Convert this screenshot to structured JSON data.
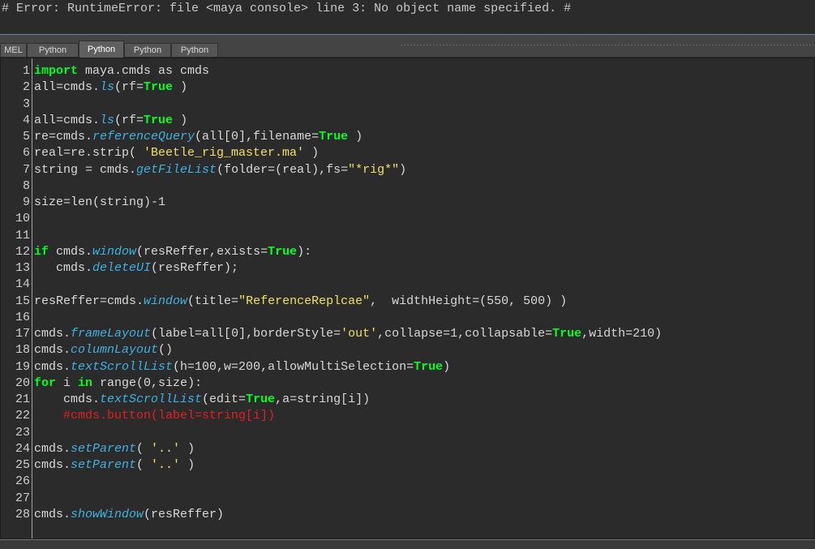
{
  "output": {
    "error_line": "# Error: RuntimeError: file <maya console> line 3: No object name specified. #"
  },
  "tabs": [
    {
      "label": "MEL",
      "active": false
    },
    {
      "label": "Python",
      "active": false
    },
    {
      "label": "Python",
      "active": true
    },
    {
      "label": "Python",
      "active": false
    },
    {
      "label": "Python",
      "active": false
    }
  ],
  "code_colors": {
    "keyword": "#00ff22",
    "function": "#3fb2e0",
    "string": "#f0e060",
    "comment": "#e02020",
    "plain": "#d8d8d8"
  },
  "code_lines": [
    {
      "n": "1",
      "tokens": [
        [
          "k",
          "import"
        ],
        [
          "p",
          " maya.cmds as cmds"
        ]
      ]
    },
    {
      "n": "2",
      "tokens": [
        [
          "p",
          "all=cmds."
        ],
        [
          "f",
          "ls"
        ],
        [
          "p",
          "(rf="
        ],
        [
          "k",
          "True"
        ],
        [
          "p",
          " )"
        ]
      ]
    },
    {
      "n": "3",
      "tokens": []
    },
    {
      "n": "4",
      "tokens": [
        [
          "p",
          "all=cmds."
        ],
        [
          "f",
          "ls"
        ],
        [
          "p",
          "(rf="
        ],
        [
          "k",
          "True"
        ],
        [
          "p",
          " )"
        ]
      ]
    },
    {
      "n": "5",
      "tokens": [
        [
          "p",
          "re=cmds."
        ],
        [
          "f",
          "referenceQuery"
        ],
        [
          "p",
          "(all[0],filename="
        ],
        [
          "k",
          "True"
        ],
        [
          "p",
          " )"
        ]
      ]
    },
    {
      "n": "6",
      "tokens": [
        [
          "p",
          "real=re.strip( "
        ],
        [
          "s",
          "'Beetle_rig_master.ma'"
        ],
        [
          "p",
          " )"
        ]
      ]
    },
    {
      "n": "7",
      "tokens": [
        [
          "p",
          "string = cmds."
        ],
        [
          "f",
          "getFileList"
        ],
        [
          "p",
          "(folder=(real),fs="
        ],
        [
          "s",
          "\"*rig*\""
        ],
        [
          "p",
          ")"
        ]
      ]
    },
    {
      "n": "8",
      "tokens": []
    },
    {
      "n": "9",
      "tokens": [
        [
          "p",
          "size=len(string)-1"
        ]
      ]
    },
    {
      "n": "10",
      "tokens": []
    },
    {
      "n": "11",
      "tokens": []
    },
    {
      "n": "12",
      "tokens": [
        [
          "k",
          "if"
        ],
        [
          "p",
          " cmds."
        ],
        [
          "f",
          "window"
        ],
        [
          "p",
          "(resReffer,exists="
        ],
        [
          "k",
          "True"
        ],
        [
          "p",
          "):"
        ]
      ]
    },
    {
      "n": "13",
      "tokens": [
        [
          "p",
          "   cmds."
        ],
        [
          "f",
          "deleteUI"
        ],
        [
          "p",
          "(resReffer);"
        ]
      ]
    },
    {
      "n": "14",
      "tokens": []
    },
    {
      "n": "15",
      "tokens": [
        [
          "p",
          "resReffer=cmds."
        ],
        [
          "f",
          "window"
        ],
        [
          "p",
          "(title="
        ],
        [
          "s",
          "\"ReferenceReplcae\""
        ],
        [
          "p",
          ",  widthHeight=(550, 500) )"
        ]
      ]
    },
    {
      "n": "16",
      "tokens": []
    },
    {
      "n": "17",
      "tokens": [
        [
          "p",
          "cmds."
        ],
        [
          "f",
          "frameLayout"
        ],
        [
          "p",
          "(label=all[0],borderStyle="
        ],
        [
          "s",
          "'out'"
        ],
        [
          "p",
          ",collapse=1,collapsable="
        ],
        [
          "k",
          "True"
        ],
        [
          "p",
          ",width=210)"
        ]
      ]
    },
    {
      "n": "18",
      "tokens": [
        [
          "p",
          "cmds."
        ],
        [
          "f",
          "columnLayout"
        ],
        [
          "p",
          "()"
        ]
      ]
    },
    {
      "n": "19",
      "tokens": [
        [
          "p",
          "cmds."
        ],
        [
          "f",
          "textScrollList"
        ],
        [
          "p",
          "(h=100,w=200,allowMultiSelection="
        ],
        [
          "k",
          "True"
        ],
        [
          "p",
          ")"
        ]
      ]
    },
    {
      "n": "20",
      "tokens": [
        [
          "k",
          "for"
        ],
        [
          "p",
          " i "
        ],
        [
          "k",
          "in"
        ],
        [
          "p",
          " range(0,size):"
        ]
      ]
    },
    {
      "n": "21",
      "tokens": [
        [
          "p",
          "    cmds."
        ],
        [
          "f",
          "textScrollList"
        ],
        [
          "p",
          "(edit="
        ],
        [
          "k",
          "True"
        ],
        [
          "p",
          ",a=string[i])"
        ]
      ]
    },
    {
      "n": "22",
      "tokens": [
        [
          "p",
          "    "
        ],
        [
          "c",
          "#cmds.button(label=string[i])"
        ]
      ]
    },
    {
      "n": "23",
      "tokens": []
    },
    {
      "n": "24",
      "tokens": [
        [
          "p",
          "cmds."
        ],
        [
          "f",
          "setParent"
        ],
        [
          "p",
          "( "
        ],
        [
          "s",
          "'..'"
        ],
        [
          "p",
          " )"
        ]
      ]
    },
    {
      "n": "25",
      "tokens": [
        [
          "p",
          "cmds."
        ],
        [
          "f",
          "setParent"
        ],
        [
          "p",
          "( "
        ],
        [
          "s",
          "'..'"
        ],
        [
          "p",
          " )"
        ]
      ]
    },
    {
      "n": "26",
      "tokens": []
    },
    {
      "n": "27",
      "tokens": []
    },
    {
      "n": "28",
      "tokens": [
        [
          "p",
          "cmds."
        ],
        [
          "f",
          "showWindow"
        ],
        [
          "p",
          "(resReffer)"
        ]
      ]
    }
  ]
}
